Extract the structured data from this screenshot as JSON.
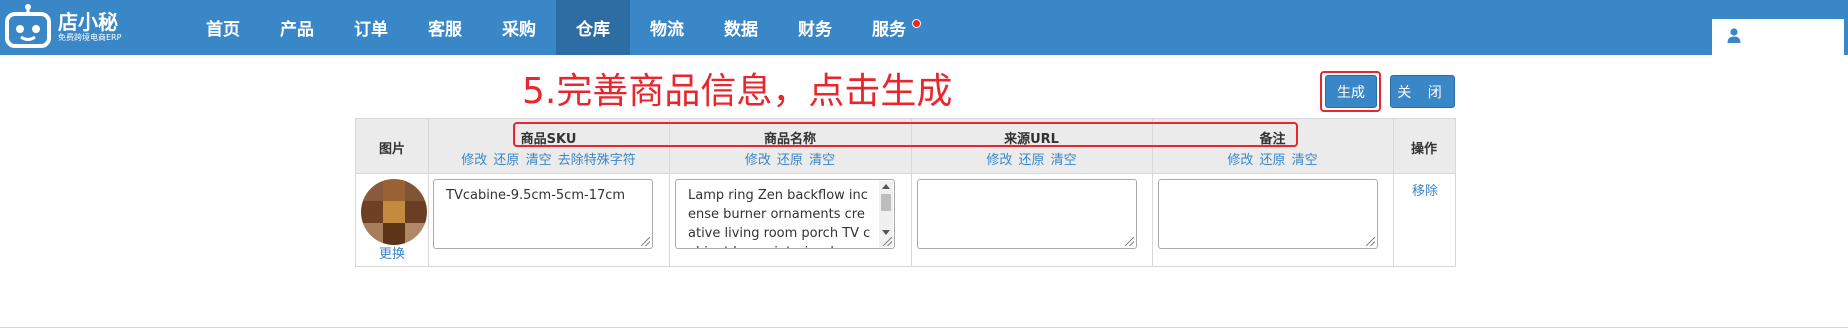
{
  "app": {
    "logo_name": "店小秘",
    "logo_tagline": "免费跨境电商ERP"
  },
  "nav": {
    "items": [
      {
        "label": "首页"
      },
      {
        "label": "产品"
      },
      {
        "label": "订单"
      },
      {
        "label": "客服"
      },
      {
        "label": "采购"
      },
      {
        "label": "仓库",
        "active": true
      },
      {
        "label": "物流"
      },
      {
        "label": "数据"
      },
      {
        "label": "财务"
      },
      {
        "label": "服务",
        "badge": "red-dot"
      }
    ]
  },
  "user": {
    "icon": "user-icon"
  },
  "annotation": {
    "text": "5.完善商品信息，点击生成"
  },
  "buttons": {
    "generate": "生成",
    "close": "关 闭"
  },
  "table": {
    "columns": {
      "image": {
        "title": "图片"
      },
      "sku": {
        "title": "商品SKU",
        "actions": [
          "修改",
          "还原",
          "清空",
          "去除特殊字符"
        ]
      },
      "name": {
        "title": "商品名称",
        "actions": [
          "修改",
          "还原",
          "清空"
        ]
      },
      "source_url": {
        "title": "来源URL",
        "actions": [
          "修改",
          "还原",
          "清空"
        ]
      },
      "note": {
        "title": "备注",
        "actions": [
          "修改",
          "还原",
          "清空"
        ]
      },
      "operation": {
        "title": "操作"
      }
    },
    "row": {
      "replace_label": "更换",
      "sku_value": "TVcabine-9.5cm-5cm-17cm",
      "name_value": "Lamp ring Zen backflow incense burner ornaments creative living room porch TV cabinet home interior decoration",
      "source_url_value": "",
      "note_value": "",
      "remove_label": "移除"
    }
  },
  "colors": {
    "nav_bg": "#3a87c8",
    "nav_active": "#2e6da4",
    "annotation_red": "#e8262d",
    "link_blue": "#3a87c8",
    "header_bg": "#ebebeb"
  }
}
